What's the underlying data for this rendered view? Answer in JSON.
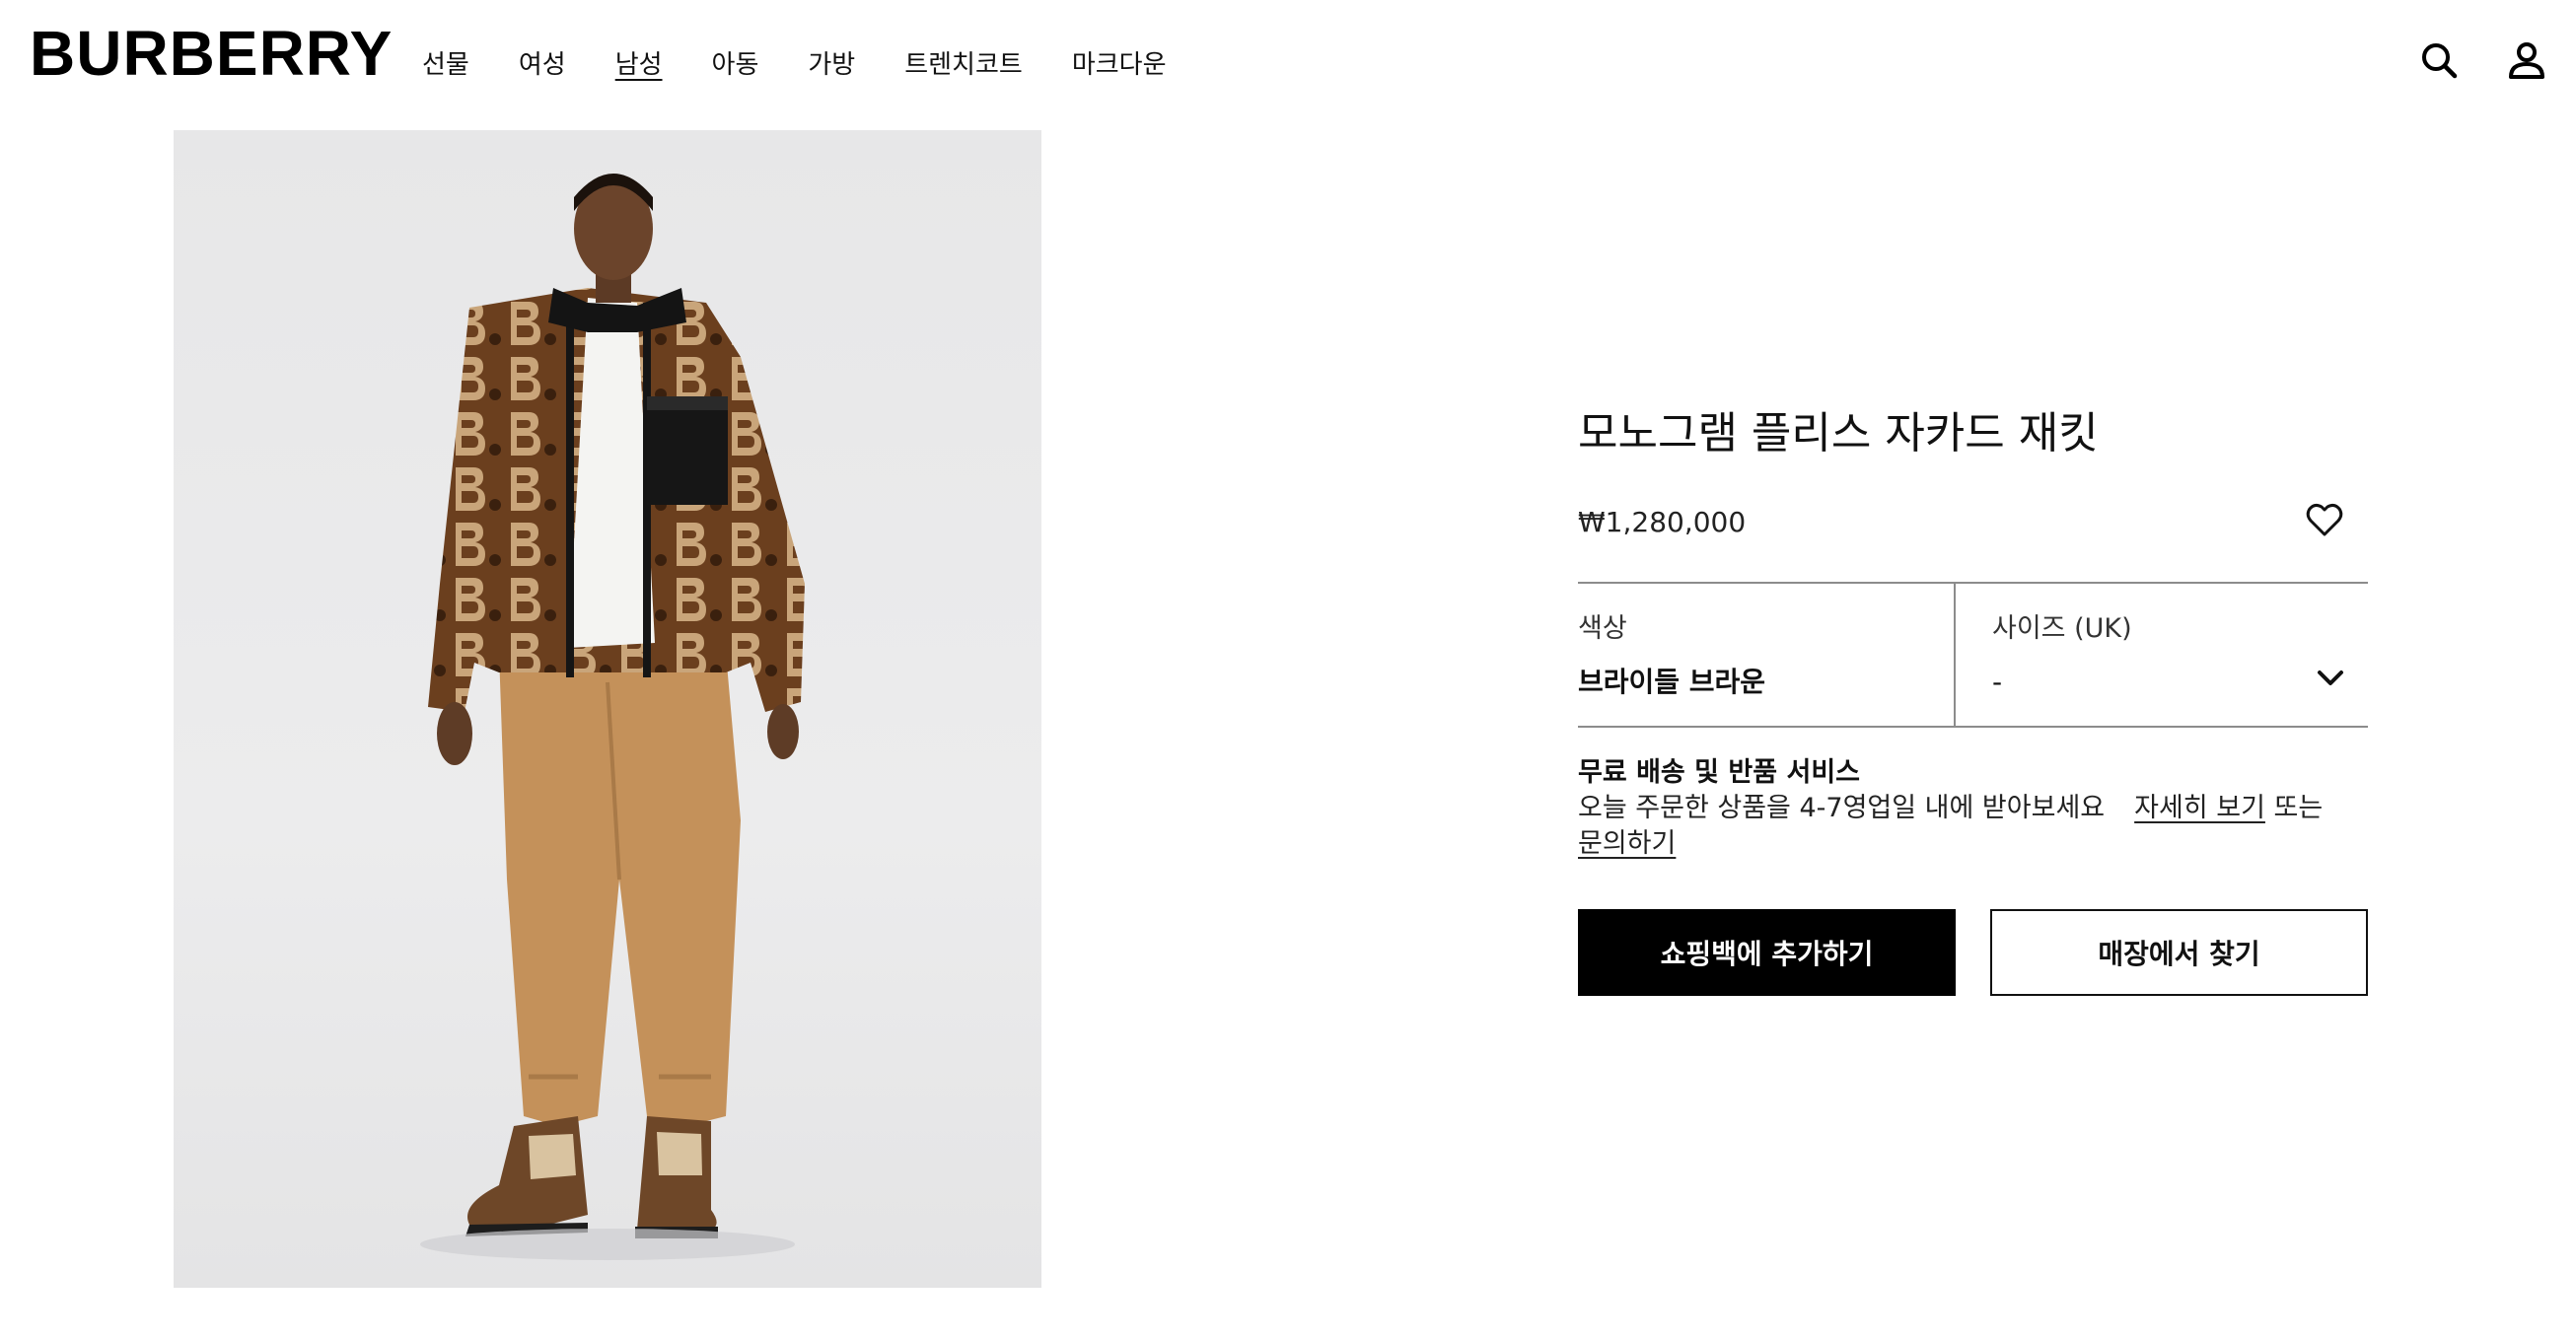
{
  "header": {
    "logo": "BURBERRY",
    "nav": [
      "선물",
      "여성",
      "남성",
      "아동",
      "가방",
      "트렌치코트",
      "마크다운"
    ],
    "active_nav": "남성",
    "icons": [
      "search-icon",
      "account-icon"
    ]
  },
  "product": {
    "title": "모노그램 플리스 자카드 재킷",
    "price": "₩1,280,000",
    "wishlist_icon": "heart-icon",
    "color_label": "색상",
    "color_value": "브라이들 브라운",
    "size_label": "사이즈 (UK)",
    "size_value": "-",
    "shipping_title": "무료 배송 및 반품 서비스",
    "shipping_text": "오늘 주문한 상품을 4-7영업일 내에 받아보세요",
    "details_link": "자세히 보기",
    "or_text": "또는",
    "inquiry_link": "문의하기",
    "add_to_bag": "쇼핑백에 추가하기",
    "find_in_store": "매장에서 찾기"
  },
  "colors": {
    "accent": "#000000",
    "divider": "#8c8c8c",
    "jacket_brown": "#6b3f1e",
    "trousers_tan": "#c4915a"
  }
}
